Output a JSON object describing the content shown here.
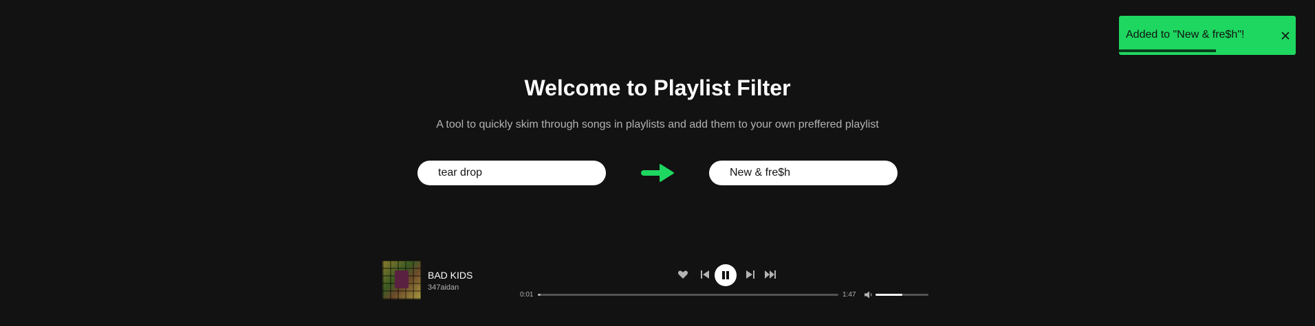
{
  "header": {
    "title": "Welcome to Playlist Filter",
    "subtitle": "A tool to quickly skim through songs in playlists and add them to your own preffered playlist"
  },
  "playlists": {
    "source": "tear drop",
    "destination": "New & fre$h",
    "arrow_icon": "arrow-right-icon"
  },
  "toast": {
    "message": "Added to \"New & fre$h\"!",
    "close_icon": "close-icon",
    "remaining_fraction": 0.55
  },
  "player": {
    "track_title": "BAD KIDS",
    "artist": "347aidan",
    "current_time": "0:01",
    "duration": "1:47",
    "progress_fraction": 0.01,
    "volume_fraction": 0.5,
    "controls": [
      "heart-icon",
      "previous-icon",
      "pause-icon",
      "next-icon",
      "skip-forward-icon",
      "volume-icon"
    ]
  },
  "colors": {
    "background": "#121212",
    "accent": "#1ed760",
    "text": "#ffffff",
    "muted_text": "#b3b3b3"
  }
}
